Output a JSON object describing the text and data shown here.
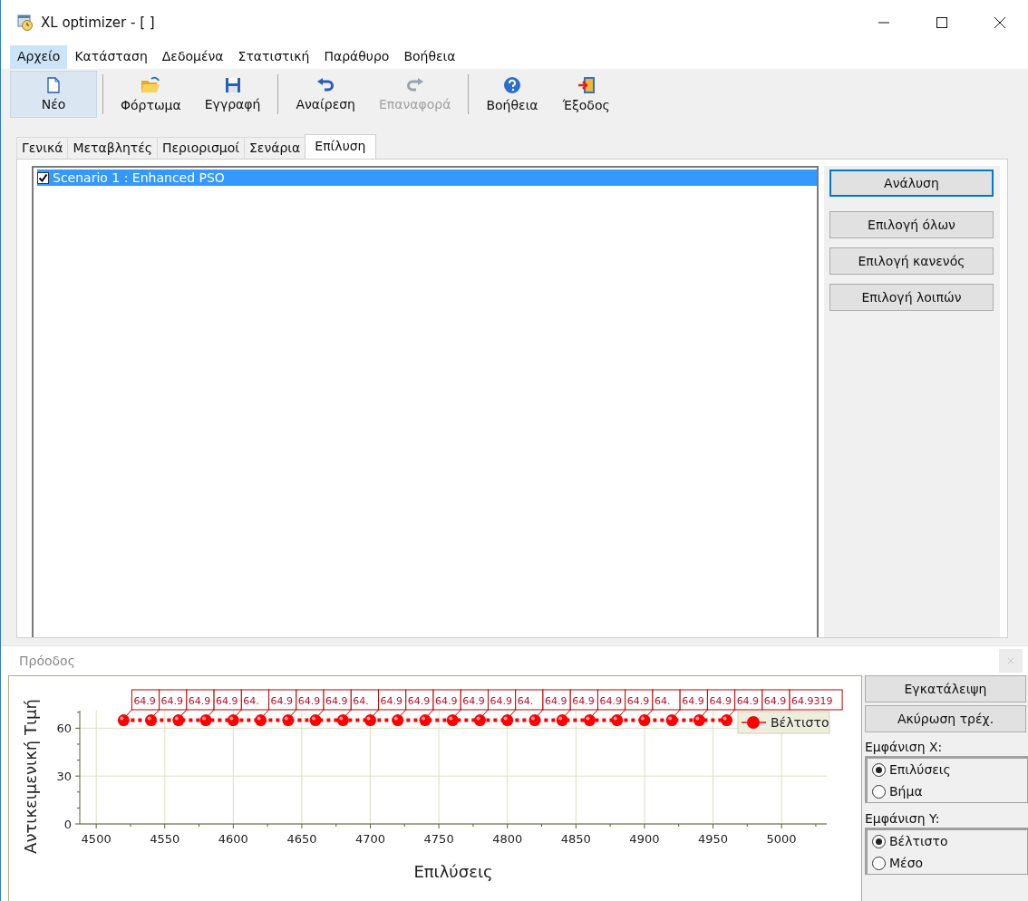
{
  "window": {
    "title": "XL optimizer - [ ]"
  },
  "menu": [
    {
      "label": "Αρχείο",
      "selected": true
    },
    {
      "label": "Κατάσταση",
      "selected": false
    },
    {
      "label": "Δεδομένα",
      "selected": false
    },
    {
      "label": "Στατιστική",
      "selected": false
    },
    {
      "label": "Παράθυρο",
      "selected": false
    },
    {
      "label": "Βοήθεια",
      "selected": false
    }
  ],
  "toolbar": [
    {
      "kind": "new",
      "label": "Νέο",
      "selected": true,
      "disabled": false
    },
    {
      "kind": "separator"
    },
    {
      "kind": "open",
      "label": "Φόρτωμα",
      "selected": false,
      "disabled": false
    },
    {
      "kind": "save",
      "label": "Εγγραφή",
      "selected": false,
      "disabled": false
    },
    {
      "kind": "separator"
    },
    {
      "kind": "undo",
      "label": "Αναίρεση",
      "selected": false,
      "disabled": false
    },
    {
      "kind": "redo",
      "label": "Επαναφορά",
      "selected": false,
      "disabled": true
    },
    {
      "kind": "separator"
    },
    {
      "kind": "help",
      "label": "Βοήθεια",
      "selected": false,
      "disabled": false
    },
    {
      "kind": "exit",
      "label": "Έξοδος",
      "selected": false,
      "disabled": false
    }
  ],
  "tabs": [
    {
      "label": "Γενικά",
      "selected": false
    },
    {
      "label": "Μεταβλητές",
      "selected": false
    },
    {
      "label": "Περιορισμοί",
      "selected": false
    },
    {
      "label": "Σενάρια",
      "selected": false
    },
    {
      "label": "Επίλυση",
      "selected": true
    }
  ],
  "scenarios": [
    {
      "label": "Scenario 1 : Enhanced PSO",
      "checked": true,
      "selected": true
    }
  ],
  "side_buttons": [
    {
      "label": "Ανάλυση",
      "selected": true
    },
    {
      "label": "Επιλογή όλων",
      "selected": false
    },
    {
      "label": "Επιλογή κανενός",
      "selected": false
    },
    {
      "label": "Επιλογή λοιπών",
      "selected": false
    }
  ],
  "progress": {
    "title": "Πρόοδος",
    "chart_data": {
      "type": "line",
      "xlabel": "Επιλύσεις",
      "ylabel": "Αντικειμενική Τιμή",
      "grid": true,
      "x": [
        4520,
        4540,
        4560,
        4580,
        4600,
        4620,
        4640,
        4660,
        4680,
        4700,
        4720,
        4740,
        4760,
        4780,
        4800,
        4820,
        4840,
        4860,
        4880,
        4900,
        4920,
        4940,
        4960
      ],
      "series": [
        {
          "name": "Βέλτιστο",
          "color": "#ff0000",
          "line_style": "dotted",
          "marker": "circle",
          "values": [
            65,
            65,
            65,
            65,
            65,
            65,
            65,
            65,
            65,
            65,
            65,
            65,
            65,
            65,
            65,
            65,
            65,
            65,
            65,
            65,
            65,
            65,
            65
          ]
        }
      ],
      "value_labels": [
        "64.9",
        "64.9",
        "64.9",
        "64.9",
        "64.",
        "64.9",
        "64.9",
        "64.9",
        "64.",
        "64.9",
        "64.9",
        "64.9",
        "64.9",
        "64.9",
        "64.",
        "64.9",
        "64.9",
        "64.9",
        "64.9",
        "64.",
        "64.9",
        "64.9",
        "64.9",
        "64.9",
        "64.9319"
      ],
      "xlim": [
        4488,
        5033
      ],
      "ylim": [
        0,
        71
      ],
      "xticks": [
        4500,
        4550,
        4600,
        4650,
        4700,
        4750,
        4800,
        4850,
        4900,
        4950,
        5000
      ],
      "yticks": [
        0,
        30,
        60
      ]
    },
    "buttons": [
      "Εγκατάλειψη",
      "Ακύρωση τρέχ."
    ],
    "x_group": {
      "title": "Εμφάνιση X:",
      "options": [
        {
          "label": "Επιλύσεις",
          "selected": true
        },
        {
          "label": "Βήμα",
          "selected": false
        }
      ]
    },
    "y_group": {
      "title": "Εμφάνιση Y:",
      "options": [
        {
          "label": "Βέλτιστο",
          "selected": true
        },
        {
          "label": "Μέσο",
          "selected": false
        }
      ]
    }
  }
}
